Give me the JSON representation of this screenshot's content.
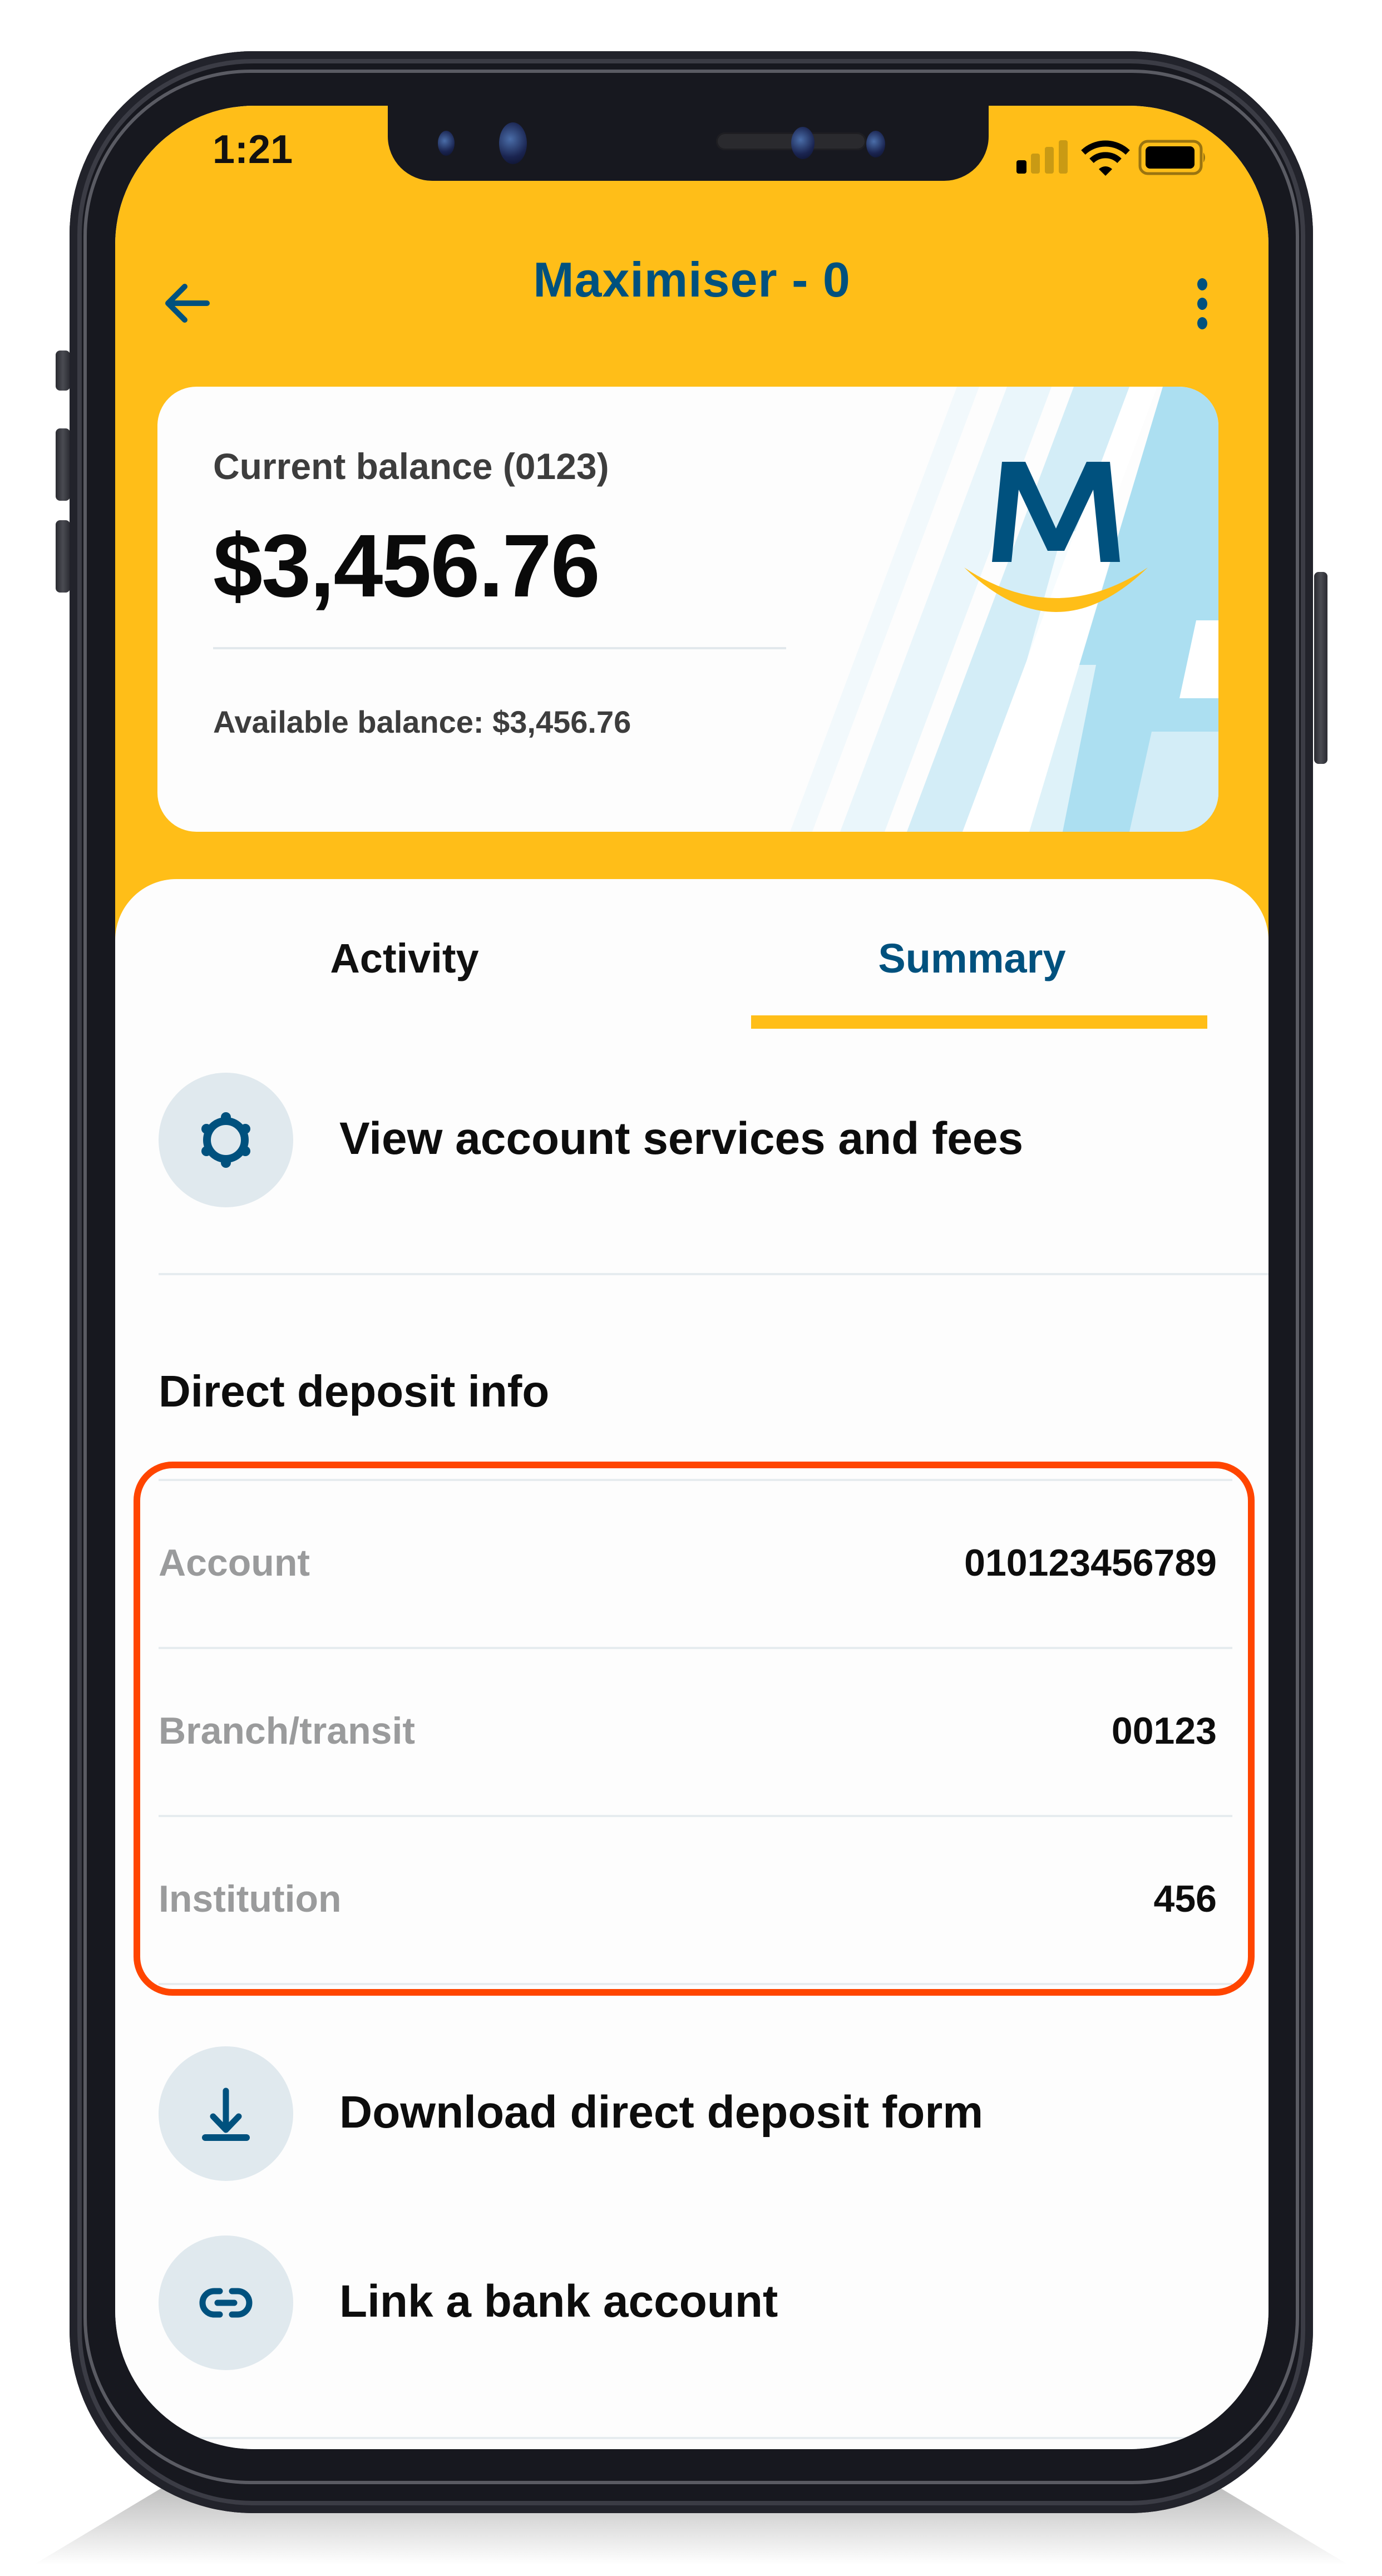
{
  "status_bar": {
    "time": "1:21",
    "signal_bars_filled": 1,
    "signal_bars_total": 4,
    "wifi": "wifi-icon",
    "battery": "battery-full-icon"
  },
  "top_bar": {
    "back_icon": "arrow-left-icon",
    "title": "Maximiser - 0",
    "more_icon": "more-vertical-icon"
  },
  "balance_card": {
    "current_balance_label": "Current balance (0123)",
    "current_balance": "$3,456.76",
    "available_balance_text": "Available balance: $3,456.76",
    "logo": "bank-m-smile-logo"
  },
  "tabs": [
    {
      "label": "Activity",
      "active": false
    },
    {
      "label": "Summary",
      "active": true
    }
  ],
  "services_link": {
    "icon": "gear-icon",
    "label": "View account services and fees"
  },
  "direct_deposit": {
    "title": "Direct deposit info",
    "rows": [
      {
        "label": "Account",
        "value": "010123456789"
      },
      {
        "label": "Branch/transit",
        "value": "00123"
      },
      {
        "label": "Institution",
        "value": "456"
      }
    ]
  },
  "actions": [
    {
      "icon": "download-icon",
      "label": "Download direct deposit form"
    },
    {
      "icon": "link-icon",
      "label": "Link a bank account"
    }
  ],
  "colors": {
    "header_yellow": "#ffbe18",
    "brand_blue": "#00517e",
    "highlight_red": "#ff4500",
    "icon_circle": "#e0e9ee"
  }
}
